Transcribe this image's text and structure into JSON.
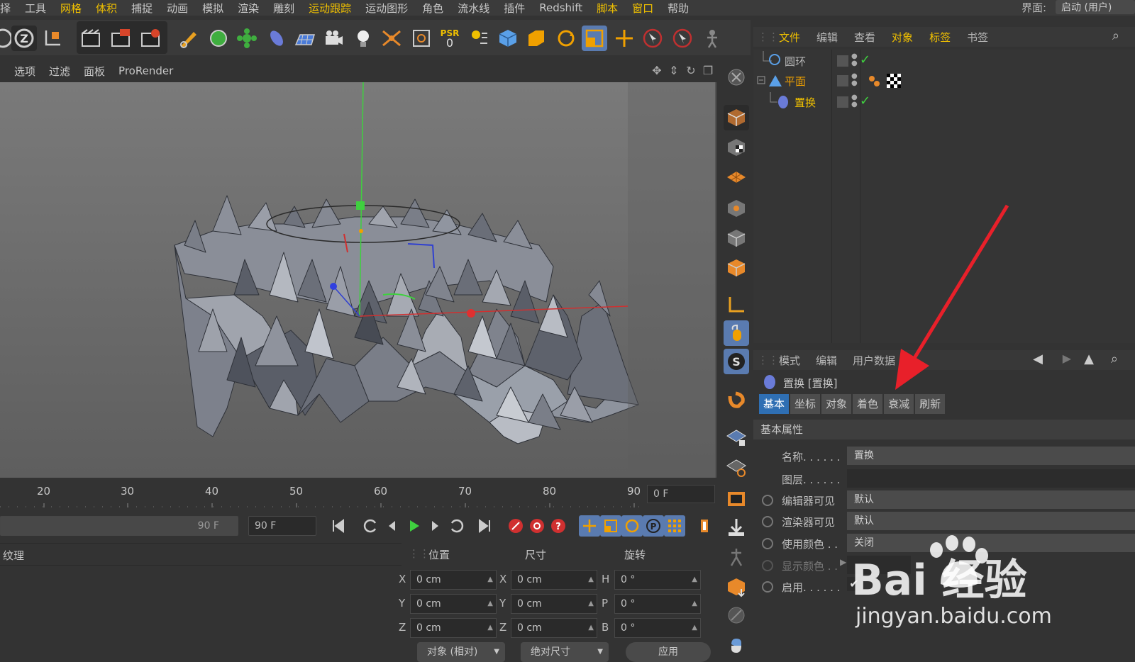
{
  "menubar": {
    "items": [
      {
        "label": "择",
        "hl": false
      },
      {
        "label": "工具",
        "hl": false
      },
      {
        "label": "网格",
        "hl": true
      },
      {
        "label": "体积",
        "hl": true
      },
      {
        "label": "捕捉",
        "hl": false
      },
      {
        "label": "动画",
        "hl": false
      },
      {
        "label": "模拟",
        "hl": false
      },
      {
        "label": "渲染",
        "hl": false
      },
      {
        "label": "雕刻",
        "hl": false
      },
      {
        "label": "运动跟踪",
        "hl": true
      },
      {
        "label": "运动图形",
        "hl": false
      },
      {
        "label": "角色",
        "hl": false
      },
      {
        "label": "流水线",
        "hl": false
      },
      {
        "label": "插件",
        "hl": false
      },
      {
        "label": "Redshift",
        "hl": false
      },
      {
        "label": "脚本",
        "hl": true
      },
      {
        "label": "窗口",
        "hl": true
      },
      {
        "label": "帮助",
        "hl": false
      }
    ],
    "ui_label": "界面:",
    "ui_value": "启动 (用户)"
  },
  "toolbar": {
    "psr_label": "PSR",
    "psr_value": "0"
  },
  "viewport": {
    "menu": [
      "选项",
      "过滤",
      "面板",
      "ProRender"
    ]
  },
  "timeline": {
    "ticks": [
      "20",
      "30",
      "40",
      "50",
      "60",
      "70",
      "80",
      "90"
    ],
    "current_frame": "0 F"
  },
  "transport": {
    "end_frame_slider": "90 F",
    "end_frame": "90 F"
  },
  "material_panel": {
    "title": "纹理"
  },
  "coords": {
    "headers": {
      "position": "位置",
      "size": "尺寸",
      "rotation": "旋转"
    },
    "axes_pos": [
      "X",
      "Y",
      "Z"
    ],
    "axes_rot": [
      "H",
      "P",
      "B"
    ],
    "position": [
      "0 cm",
      "0 cm",
      "0 cm"
    ],
    "size": [
      "0 cm",
      "0 cm",
      "0 cm"
    ],
    "rotation": [
      "0 °",
      "0 °",
      "0 °"
    ],
    "mode": "对象 (相对)",
    "size_mode": "绝对尺寸",
    "apply": "应用"
  },
  "object_manager": {
    "menu": [
      {
        "label": "文件",
        "hl": true
      },
      {
        "label": "编辑",
        "hl": false
      },
      {
        "label": "查看",
        "hl": false
      },
      {
        "label": "对象",
        "hl": true
      },
      {
        "label": "标签",
        "hl": true
      },
      {
        "label": "书签",
        "hl": false
      }
    ],
    "objects": [
      {
        "name": "圆环",
        "color": "#b8b8b8"
      },
      {
        "name": "平面",
        "color": "#f0a000"
      },
      {
        "name": "置换",
        "color": "#f0c000"
      }
    ]
  },
  "attributes": {
    "menu": [
      "模式",
      "编辑",
      "用户数据"
    ],
    "title": "置换 [置换]",
    "tabs": [
      {
        "label": "基本",
        "active": true
      },
      {
        "label": "坐标",
        "active": false
      },
      {
        "label": "对象",
        "active": false
      },
      {
        "label": "着色",
        "active": false
      },
      {
        "label": "衰减",
        "active": false
      },
      {
        "label": "刷新",
        "active": false
      }
    ],
    "section": "基本属性",
    "props": [
      {
        "label": "名称. . . . . .",
        "value": "置换"
      },
      {
        "label": "图层. . . . . .",
        "value": ""
      },
      {
        "label": "编辑器可见",
        "value": "默认"
      },
      {
        "label": "渲染器可见",
        "value": "默认"
      },
      {
        "label": "使用颜色 . .",
        "value": "关闭"
      },
      {
        "label": "显示颜色 . .",
        "value": ""
      },
      {
        "label": "启用. . . . . .",
        "value": "✔"
      }
    ]
  },
  "watermark": {
    "brand": "Bai 经验",
    "url": "jingyan.baidu.com"
  },
  "colors": {
    "accent_yellow": "#f0c000",
    "tab_active": "#2f6fb3",
    "arrow_red": "#e8202a"
  }
}
